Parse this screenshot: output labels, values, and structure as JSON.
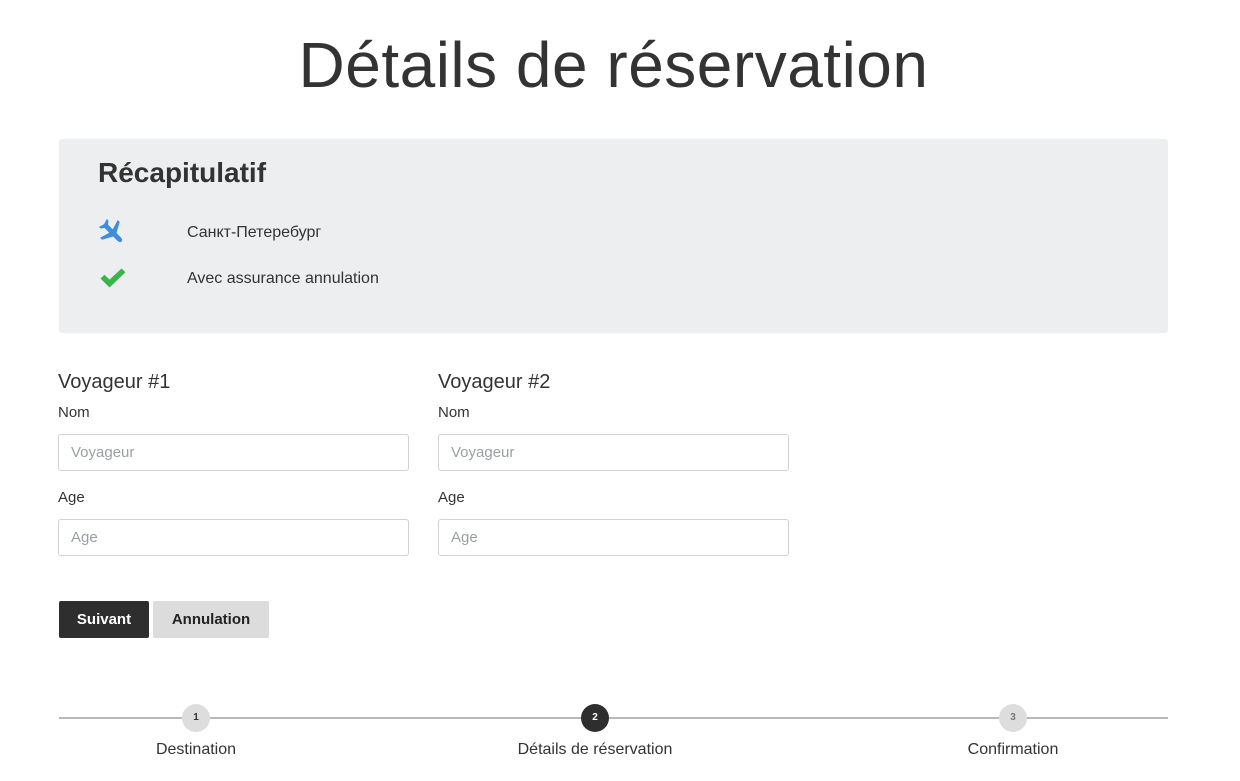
{
  "page": {
    "title": "Détails de réservation"
  },
  "summary": {
    "title": "Récapitulatif",
    "destination": {
      "icon": "plane-icon",
      "text": "Санкт-Петеребург",
      "icon_color": "#3d8ee0"
    },
    "insurance": {
      "icon": "check-icon",
      "text": "Avec assurance annulation",
      "icon_color": "#3bb54a"
    }
  },
  "travelers": [
    {
      "heading": "Voyageur #1",
      "name_label": "Nom",
      "name_value": "",
      "name_placeholder": "Voyageur",
      "age_label": "Age",
      "age_value": "",
      "age_placeholder": "Age"
    },
    {
      "heading": "Voyageur #2",
      "name_label": "Nom",
      "name_value": "",
      "name_placeholder": "Voyageur",
      "age_label": "Age",
      "age_value": "",
      "age_placeholder": "Age"
    }
  ],
  "actions": {
    "next_label": "Suivant",
    "cancel_label": "Annulation"
  },
  "stepper": {
    "current_step": 2,
    "steps": [
      {
        "number": "1",
        "label": "Destination"
      },
      {
        "number": "2",
        "label": "Détails de réservation"
      },
      {
        "number": "3",
        "label": "Confirmation"
      }
    ]
  },
  "colors": {
    "accent_dark": "#2e2e2e",
    "summary_background": "#eceeef"
  }
}
